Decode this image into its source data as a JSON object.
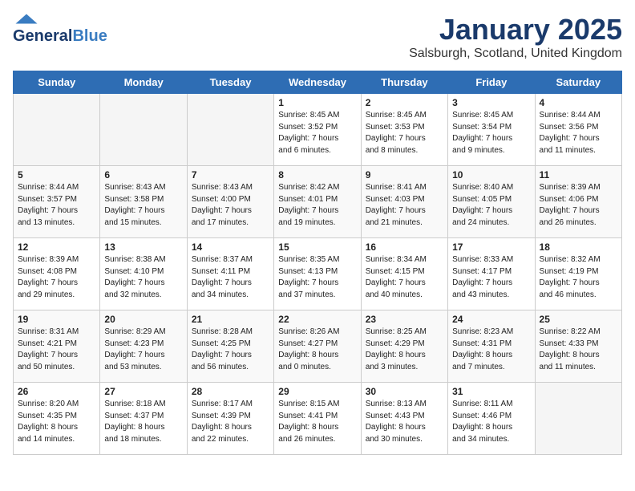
{
  "header": {
    "logo_general": "General",
    "logo_blue": "Blue",
    "title": "January 2025",
    "subtitle": "Salsburgh, Scotland, United Kingdom"
  },
  "days_of_week": [
    "Sunday",
    "Monday",
    "Tuesday",
    "Wednesday",
    "Thursday",
    "Friday",
    "Saturday"
  ],
  "weeks": [
    [
      {
        "day": "",
        "info": ""
      },
      {
        "day": "",
        "info": ""
      },
      {
        "day": "",
        "info": ""
      },
      {
        "day": "1",
        "info": "Sunrise: 8:45 AM\nSunset: 3:52 PM\nDaylight: 7 hours\nand 6 minutes."
      },
      {
        "day": "2",
        "info": "Sunrise: 8:45 AM\nSunset: 3:53 PM\nDaylight: 7 hours\nand 8 minutes."
      },
      {
        "day": "3",
        "info": "Sunrise: 8:45 AM\nSunset: 3:54 PM\nDaylight: 7 hours\nand 9 minutes."
      },
      {
        "day": "4",
        "info": "Sunrise: 8:44 AM\nSunset: 3:56 PM\nDaylight: 7 hours\nand 11 minutes."
      }
    ],
    [
      {
        "day": "5",
        "info": "Sunrise: 8:44 AM\nSunset: 3:57 PM\nDaylight: 7 hours\nand 13 minutes."
      },
      {
        "day": "6",
        "info": "Sunrise: 8:43 AM\nSunset: 3:58 PM\nDaylight: 7 hours\nand 15 minutes."
      },
      {
        "day": "7",
        "info": "Sunrise: 8:43 AM\nSunset: 4:00 PM\nDaylight: 7 hours\nand 17 minutes."
      },
      {
        "day": "8",
        "info": "Sunrise: 8:42 AM\nSunset: 4:01 PM\nDaylight: 7 hours\nand 19 minutes."
      },
      {
        "day": "9",
        "info": "Sunrise: 8:41 AM\nSunset: 4:03 PM\nDaylight: 7 hours\nand 21 minutes."
      },
      {
        "day": "10",
        "info": "Sunrise: 8:40 AM\nSunset: 4:05 PM\nDaylight: 7 hours\nand 24 minutes."
      },
      {
        "day": "11",
        "info": "Sunrise: 8:39 AM\nSunset: 4:06 PM\nDaylight: 7 hours\nand 26 minutes."
      }
    ],
    [
      {
        "day": "12",
        "info": "Sunrise: 8:39 AM\nSunset: 4:08 PM\nDaylight: 7 hours\nand 29 minutes."
      },
      {
        "day": "13",
        "info": "Sunrise: 8:38 AM\nSunset: 4:10 PM\nDaylight: 7 hours\nand 32 minutes."
      },
      {
        "day": "14",
        "info": "Sunrise: 8:37 AM\nSunset: 4:11 PM\nDaylight: 7 hours\nand 34 minutes."
      },
      {
        "day": "15",
        "info": "Sunrise: 8:35 AM\nSunset: 4:13 PM\nDaylight: 7 hours\nand 37 minutes."
      },
      {
        "day": "16",
        "info": "Sunrise: 8:34 AM\nSunset: 4:15 PM\nDaylight: 7 hours\nand 40 minutes."
      },
      {
        "day": "17",
        "info": "Sunrise: 8:33 AM\nSunset: 4:17 PM\nDaylight: 7 hours\nand 43 minutes."
      },
      {
        "day": "18",
        "info": "Sunrise: 8:32 AM\nSunset: 4:19 PM\nDaylight: 7 hours\nand 46 minutes."
      }
    ],
    [
      {
        "day": "19",
        "info": "Sunrise: 8:31 AM\nSunset: 4:21 PM\nDaylight: 7 hours\nand 50 minutes."
      },
      {
        "day": "20",
        "info": "Sunrise: 8:29 AM\nSunset: 4:23 PM\nDaylight: 7 hours\nand 53 minutes."
      },
      {
        "day": "21",
        "info": "Sunrise: 8:28 AM\nSunset: 4:25 PM\nDaylight: 7 hours\nand 56 minutes."
      },
      {
        "day": "22",
        "info": "Sunrise: 8:26 AM\nSunset: 4:27 PM\nDaylight: 8 hours\nand 0 minutes."
      },
      {
        "day": "23",
        "info": "Sunrise: 8:25 AM\nSunset: 4:29 PM\nDaylight: 8 hours\nand 3 minutes."
      },
      {
        "day": "24",
        "info": "Sunrise: 8:23 AM\nSunset: 4:31 PM\nDaylight: 8 hours\nand 7 minutes."
      },
      {
        "day": "25",
        "info": "Sunrise: 8:22 AM\nSunset: 4:33 PM\nDaylight: 8 hours\nand 11 minutes."
      }
    ],
    [
      {
        "day": "26",
        "info": "Sunrise: 8:20 AM\nSunset: 4:35 PM\nDaylight: 8 hours\nand 14 minutes."
      },
      {
        "day": "27",
        "info": "Sunrise: 8:18 AM\nSunset: 4:37 PM\nDaylight: 8 hours\nand 18 minutes."
      },
      {
        "day": "28",
        "info": "Sunrise: 8:17 AM\nSunset: 4:39 PM\nDaylight: 8 hours\nand 22 minutes."
      },
      {
        "day": "29",
        "info": "Sunrise: 8:15 AM\nSunset: 4:41 PM\nDaylight: 8 hours\nand 26 minutes."
      },
      {
        "day": "30",
        "info": "Sunrise: 8:13 AM\nSunset: 4:43 PM\nDaylight: 8 hours\nand 30 minutes."
      },
      {
        "day": "31",
        "info": "Sunrise: 8:11 AM\nSunset: 4:46 PM\nDaylight: 8 hours\nand 34 minutes."
      },
      {
        "day": "",
        "info": ""
      }
    ]
  ]
}
